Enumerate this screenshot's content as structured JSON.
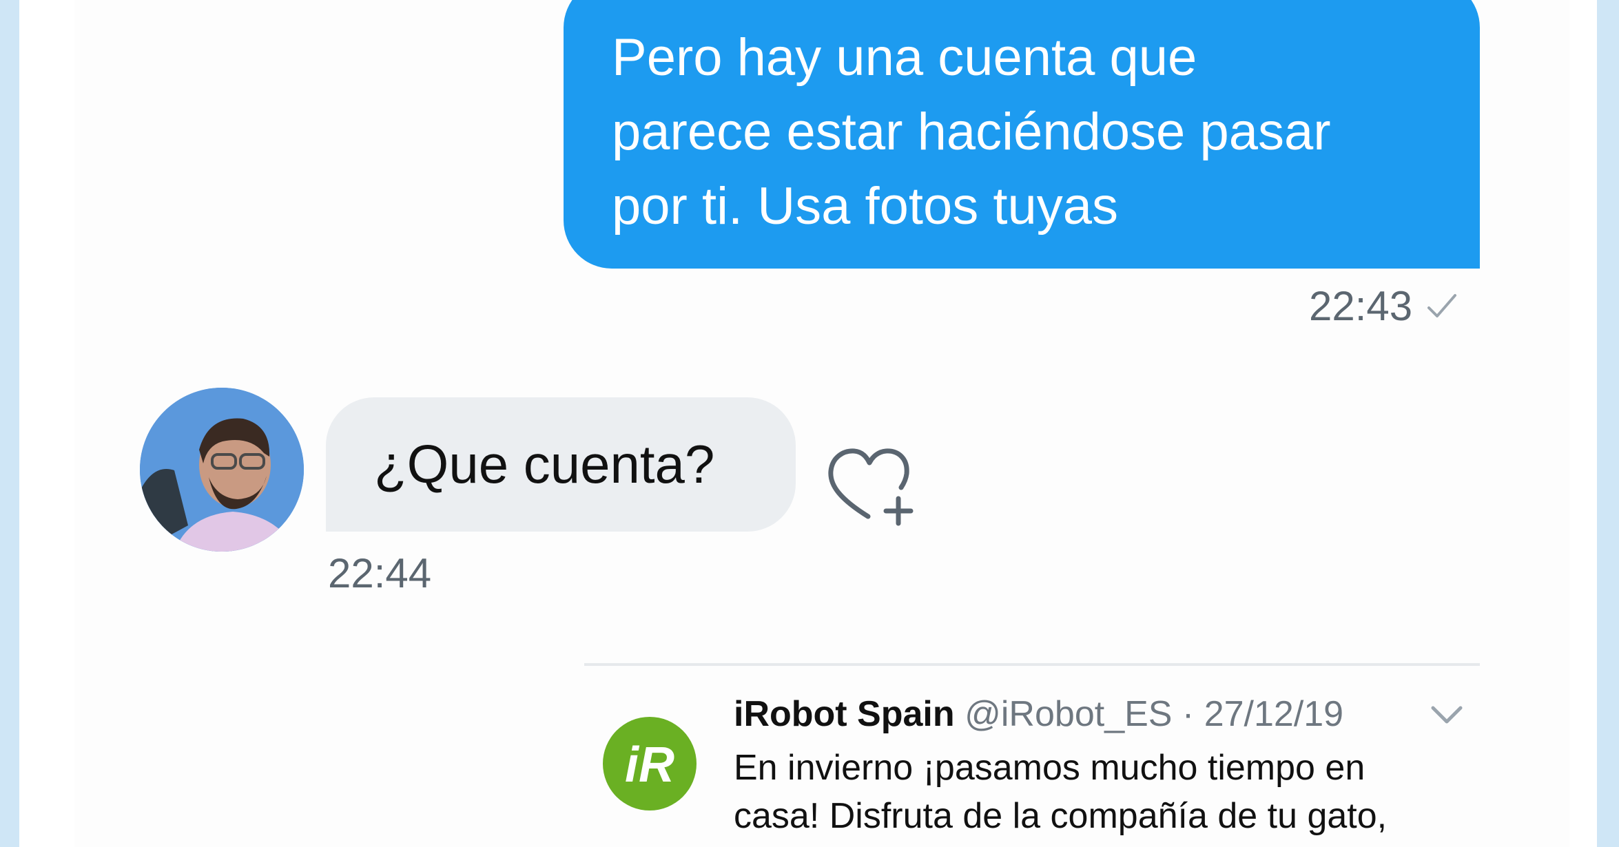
{
  "messages": [
    {
      "direction": "outgoing",
      "lines": [
        "Pero hay una cuenta que",
        "parece estar haciéndose pasar",
        "por ti. Usa fotos tuyas"
      ],
      "time": "22:43",
      "status_icon": "check-icon"
    },
    {
      "direction": "incoming",
      "text": "¿Que cuenta?",
      "time": "22:44",
      "reaction_icon": "heart-plus-icon"
    }
  ],
  "shared_tweet": {
    "author_name": "iRobot Spain",
    "handle_date": "@iRobot_ES · 27/12/19",
    "logo_text": "iR",
    "text_lines": [
      "En invierno ¡pasamos mucho tiempo en",
      "casa! Disfruta de la compañía de tu gato,"
    ]
  },
  "colors": {
    "outgoing_bubble": "#1d9bf0",
    "incoming_bubble": "#ebeef1",
    "irobot_green": "#6ab023",
    "page_border": "#cfe6f6"
  }
}
